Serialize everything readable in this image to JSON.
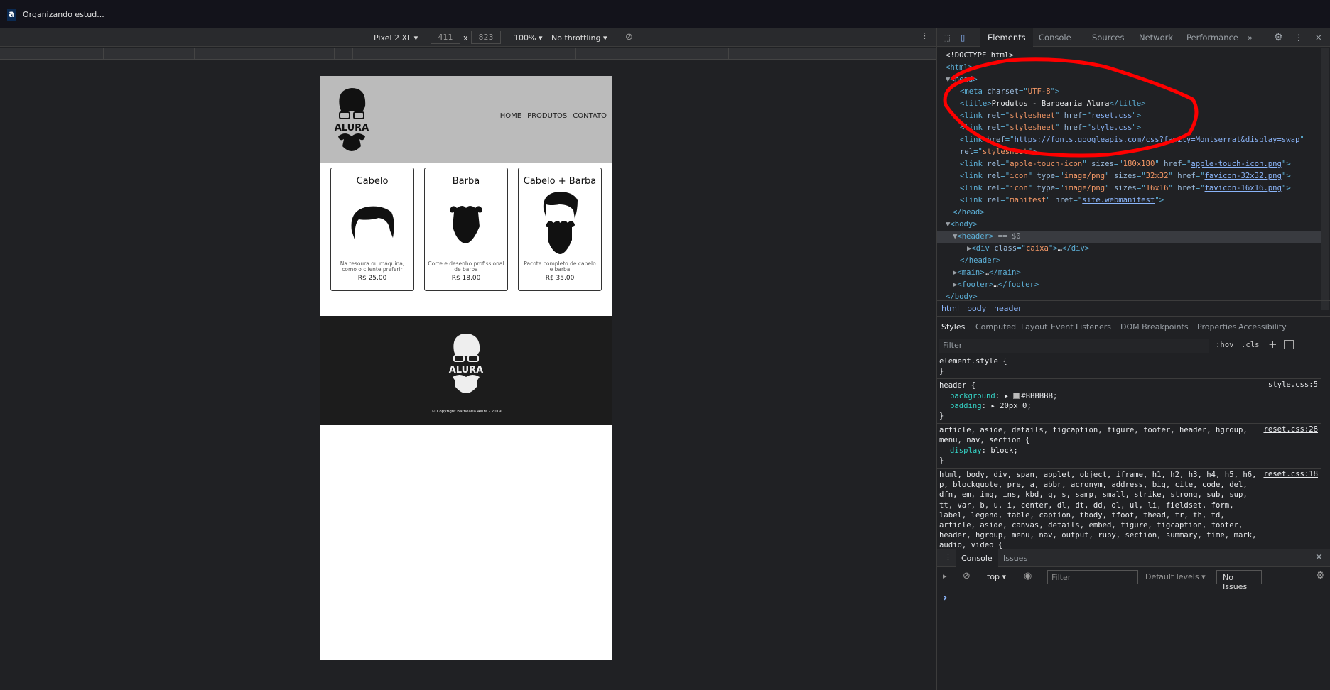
{
  "titlebar": {
    "logo": "a",
    "title": "Organizando estud..."
  },
  "device_toolbar": {
    "device": "Pixel 2 XL",
    "width": "411",
    "times": "x",
    "height": "823",
    "zoom": "100%",
    "throttling": "No throttling"
  },
  "page": {
    "logo_text": "ALURA",
    "nav": [
      "HOME",
      "PRODUTOS",
      "CONTATO"
    ],
    "cards": [
      {
        "title": "Cabelo",
        "desc": "Na tesoura ou máquina, como o cliente preferir",
        "price": "R$ 25,00",
        "icon": "hair-icon"
      },
      {
        "title": "Barba",
        "desc": "Corte e desenho profissional de barba",
        "price": "R$ 18,00",
        "icon": "beard-icon"
      },
      {
        "title": "Cabelo + Barba",
        "desc": "Pacote completo de cabelo e barba",
        "price": "R$ 35,00",
        "icon": "hair-beard-icon"
      }
    ],
    "copyright": "© Copyright Barbearia Alura - 2019"
  },
  "devtools": {
    "tabs": [
      "Elements",
      "Console",
      "Sources",
      "Network",
      "Performance"
    ],
    "more": "»",
    "tree": [
      [
        [
          "txt",
          "<!DOCTYPE html>"
        ]
      ],
      [
        [
          "tag",
          "<html>"
        ]
      ],
      [
        [
          "dim",
          "▼"
        ],
        [
          "tag",
          "<head>"
        ]
      ],
      [
        [
          "tag",
          "<meta "
        ],
        [
          "attr",
          "charset"
        ],
        [
          "tag",
          "=\""
        ],
        [
          "val",
          "UTF-8"
        ],
        [
          "tag",
          "\">"
        ]
      ],
      [
        [
          "tag",
          "<title>"
        ],
        [
          "txt",
          "Produtos - Barbearia Alura"
        ],
        [
          "tag",
          "</title>"
        ]
      ],
      [
        [
          "tag",
          "<link "
        ],
        [
          "attr",
          "rel"
        ],
        [
          "tag",
          "=\""
        ],
        [
          "val",
          "stylesheet"
        ],
        [
          "tag",
          "\" "
        ],
        [
          "attr",
          "href"
        ],
        [
          "tag",
          "=\""
        ],
        [
          "link",
          "reset.css"
        ],
        [
          "tag",
          "\">"
        ]
      ],
      [
        [
          "tag",
          "<link "
        ],
        [
          "attr",
          "rel"
        ],
        [
          "tag",
          "=\""
        ],
        [
          "val",
          "stylesheet"
        ],
        [
          "tag",
          "\" "
        ],
        [
          "attr",
          "href"
        ],
        [
          "tag",
          "=\""
        ],
        [
          "link",
          "style.css"
        ],
        [
          "tag",
          "\">"
        ]
      ],
      [
        [
          "tag",
          "<link "
        ],
        [
          "attr",
          "href"
        ],
        [
          "tag",
          "=\""
        ],
        [
          "link",
          "https://fonts.googleapis.com/css?family=Montserrat&display=swap"
        ],
        [
          "tag",
          "\""
        ]
      ],
      [
        [
          "attr",
          "rel"
        ],
        [
          "tag",
          "=\""
        ],
        [
          "val",
          "stylesheet"
        ],
        [
          "tag",
          "\">"
        ]
      ],
      [
        [
          "tag",
          "<link "
        ],
        [
          "attr",
          "rel"
        ],
        [
          "tag",
          "=\""
        ],
        [
          "val",
          "apple-touch-icon"
        ],
        [
          "tag",
          "\" "
        ],
        [
          "attr",
          "sizes"
        ],
        [
          "tag",
          "=\""
        ],
        [
          "val",
          "180x180"
        ],
        [
          "tag",
          "\" "
        ],
        [
          "attr",
          "href"
        ],
        [
          "tag",
          "=\""
        ],
        [
          "link",
          "apple-touch-icon.png"
        ],
        [
          "tag",
          "\">"
        ]
      ],
      [
        [
          "tag",
          "<link "
        ],
        [
          "attr",
          "rel"
        ],
        [
          "tag",
          "=\""
        ],
        [
          "val",
          "icon"
        ],
        [
          "tag",
          "\" "
        ],
        [
          "attr",
          "type"
        ],
        [
          "tag",
          "=\""
        ],
        [
          "val",
          "image/png"
        ],
        [
          "tag",
          "\" "
        ],
        [
          "attr",
          "sizes"
        ],
        [
          "tag",
          "=\""
        ],
        [
          "val",
          "32x32"
        ],
        [
          "tag",
          "\" "
        ],
        [
          "attr",
          "href"
        ],
        [
          "tag",
          "=\""
        ],
        [
          "link",
          "favicon-32x32.png"
        ],
        [
          "tag",
          "\">"
        ]
      ],
      [
        [
          "tag",
          "<link "
        ],
        [
          "attr",
          "rel"
        ],
        [
          "tag",
          "=\""
        ],
        [
          "val",
          "icon"
        ],
        [
          "tag",
          "\" "
        ],
        [
          "attr",
          "type"
        ],
        [
          "tag",
          "=\""
        ],
        [
          "val",
          "image/png"
        ],
        [
          "tag",
          "\" "
        ],
        [
          "attr",
          "sizes"
        ],
        [
          "tag",
          "=\""
        ],
        [
          "val",
          "16x16"
        ],
        [
          "tag",
          "\" "
        ],
        [
          "attr",
          "href"
        ],
        [
          "tag",
          "=\""
        ],
        [
          "link",
          "favicon-16x16.png"
        ],
        [
          "tag",
          "\">"
        ]
      ],
      [
        [
          "tag",
          "<link "
        ],
        [
          "attr",
          "rel"
        ],
        [
          "tag",
          "=\""
        ],
        [
          "val",
          "manifest"
        ],
        [
          "tag",
          "\" "
        ],
        [
          "attr",
          "href"
        ],
        [
          "tag",
          "=\""
        ],
        [
          "link",
          "site.webmanifest"
        ],
        [
          "tag",
          "\">"
        ]
      ],
      [
        [
          "tag",
          "</head>"
        ]
      ],
      [
        [
          "dim",
          "▼"
        ],
        [
          "tag",
          "<body>"
        ]
      ],
      [
        [
          "dim",
          "▼"
        ],
        [
          "tag",
          "<header>"
        ],
        [
          "dim",
          " == $0"
        ]
      ],
      [
        [
          "dim",
          "▶"
        ],
        [
          "tag",
          "<div "
        ],
        [
          "attr",
          "class"
        ],
        [
          "tag",
          "=\""
        ],
        [
          "val",
          "caixa"
        ],
        [
          "tag",
          "\">"
        ],
        [
          "txt",
          "…"
        ],
        [
          "tag",
          "</div>"
        ]
      ],
      [
        [
          "tag",
          "</header>"
        ]
      ],
      [
        [
          "dim",
          "▶"
        ],
        [
          "tag",
          "<main>"
        ],
        [
          "txt",
          "…"
        ],
        [
          "tag",
          "</main>"
        ]
      ],
      [
        [
          "dim",
          "▶"
        ],
        [
          "tag",
          "<footer>"
        ],
        [
          "txt",
          "…"
        ],
        [
          "tag",
          "</footer>"
        ]
      ],
      [
        [
          "tag",
          "</body>"
        ]
      ]
    ],
    "tree_indent": [
      0,
      0,
      0,
      2,
      2,
      2,
      2,
      2,
      2,
      2,
      2,
      2,
      2,
      1,
      0,
      1,
      3,
      2,
      1,
      1,
      0
    ],
    "selected_line": 15,
    "breadcrumbs": [
      "html",
      "body",
      "header"
    ],
    "styles_tabs": [
      "Styles",
      "Computed",
      "Layout",
      "Event Listeners",
      "DOM Breakpoints",
      "Properties",
      "Accessibility"
    ],
    "filter_placeholder": "Filter",
    "hov": ":hov",
    "cls": ".cls",
    "plus": "+",
    "rules": [
      {
        "selector": "element.style {",
        "props": [],
        "source": ""
      },
      {
        "selector": "header {",
        "props": [
          [
            "background",
            "#BBBBBB"
          ],
          [
            "padding",
            "20px 0"
          ]
        ],
        "source": "style.css:5",
        "swatch": "#bbbbbb"
      },
      {
        "selector": "article, aside, details, figcaption, figure, footer, header, hgroup, menu, nav, section {",
        "props": [
          [
            "display",
            "block"
          ]
        ],
        "source": "reset.css:28"
      },
      {
        "selector": "html, body, div, span, applet, object, iframe, h1, h2, h3, h4, h5, h6, p, blockquote, pre, a, abbr, acronym, address, big, cite, code, del, dfn, em, img, ins, kbd, q, s, samp, small, strike, strong, sub, sup, tt, var, b, u, i, center, dl, dt, dd, ol, ul, li, fieldset, form, label, legend, table, caption, tbody, tfoot, thead, tr, th, td, article, aside, canvas, details, embed, figure, figcaption, footer, header, hgroup, menu, nav, output, ruby, section, summary, time, mark, audio, video {",
        "props": [],
        "source": "reset.css:18",
        "open": true
      }
    ],
    "drawer": {
      "tabs": [
        "Console",
        "Issues"
      ],
      "context": "top",
      "filter_placeholder": "Filter",
      "levels": "Default levels",
      "issues": "No Issues",
      "prompt": "›"
    }
  },
  "colors": {
    "header_bg": "#BBBBBB",
    "annotation": "#ff0000",
    "accent": "#8ab4f8"
  }
}
